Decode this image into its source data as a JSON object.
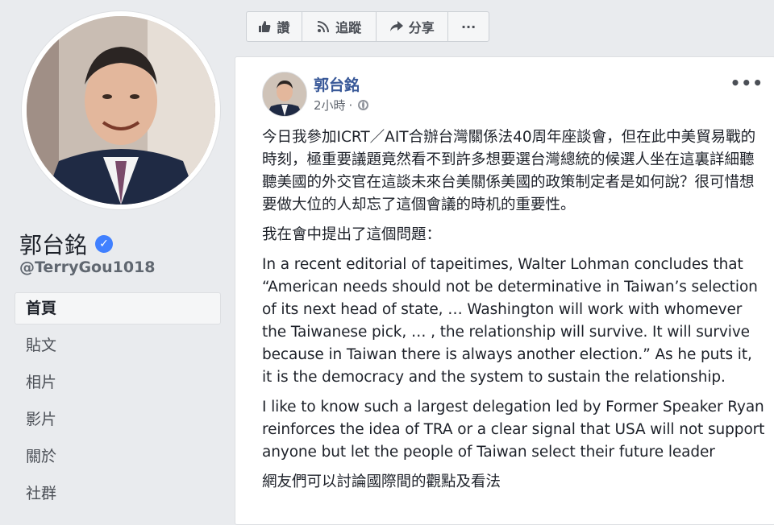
{
  "profile": {
    "name": "郭台銘",
    "handle": "@TerryGou1018",
    "verified_icon": "verified-check-icon"
  },
  "nav": {
    "items": [
      {
        "label": "首頁",
        "active": true
      },
      {
        "label": "貼文"
      },
      {
        "label": "相片"
      },
      {
        "label": "影片"
      },
      {
        "label": "關於"
      },
      {
        "label": "社群"
      }
    ]
  },
  "actions": {
    "like": "讚",
    "follow": "追蹤",
    "share": "分享",
    "more": "···"
  },
  "post": {
    "author": "郭台銘",
    "time": "2小時",
    "separator": "·",
    "menu": "•••",
    "paragraphs": [
      "今日我參加ICRT／AIT合辦台灣關係法40周年座談會，但在此中美貿易戰的時刻，極重要議題竟然看不到許多想要選台灣總統的候選人坐在這裏詳細聽聽美國的外交官在這談未來台美關係美國的政策制定者是如何說？很可惜想要做大位的人却忘了這個會議的時机的重要性。",
      "我在會中提出了這個問題：",
      "In a recent editorial of tapeitimes, Walter Lohman concludes that “American needs should not be determinative in Taiwan’s selection of its next head of state, … Washington will work with whomever the Taiwanese pick, … , the relationship will survive. It will survive because in Taiwan there is always another election.” As he puts it, it is the democracy and the system to sustain the relationship.",
      "I like to know such a largest delegation led by Former Speaker Ryan reinforces the idea of TRA or a clear signal that USA will not support anyone but let the people of Taiwan select their future leader",
      "網友們可以討論國際間的觀點及看法"
    ]
  }
}
